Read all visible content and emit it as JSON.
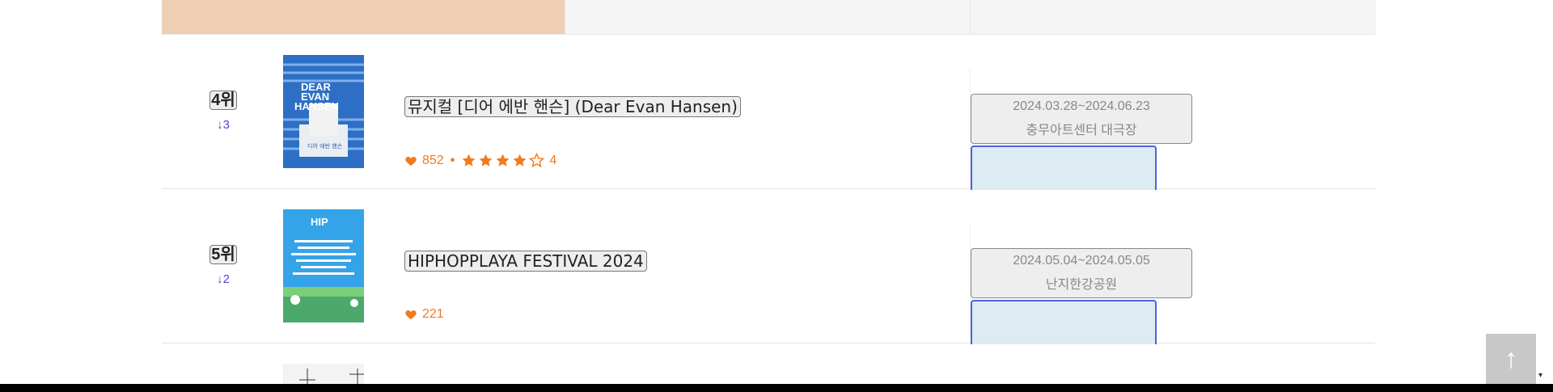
{
  "rows": [
    {
      "rank": "4위",
      "change": "↓3",
      "title": "뮤지컬 [디어 에반 핸슨]  (Dear Evan Hansen)",
      "likes": "852",
      "rating": "4",
      "stars_filled": 4,
      "stars_total": 5,
      "dates": "2024.03.28~2024.06.23",
      "venue": "충무아트센터 대극장",
      "poster": {
        "line1": "DEAR",
        "line2": "EVAN",
        "line3": "HANSEN",
        "caption": "디어 에반 핸슨"
      }
    },
    {
      "rank": "5위",
      "change": "↓2",
      "title": "HIPHOPPLAYA FESTIVAL 2024",
      "likes": "221",
      "dates": "2024.05.04~2024.05.05",
      "venue": "난지한강공원",
      "poster": {
        "line1": "HIP"
      }
    }
  ],
  "colors": {
    "accent_orange": "#f07b20",
    "rank_change": "#5a3fd6",
    "tab_active": "#efcfb3",
    "action_border": "#4f62e0",
    "action_fill": "#ddebf2"
  },
  "icons": {
    "like": "heart-icon",
    "rating": "star-icon",
    "scroll_top": "arrow-up-icon"
  },
  "scroll_top_label": "↑",
  "scroll_down_label": "▾"
}
